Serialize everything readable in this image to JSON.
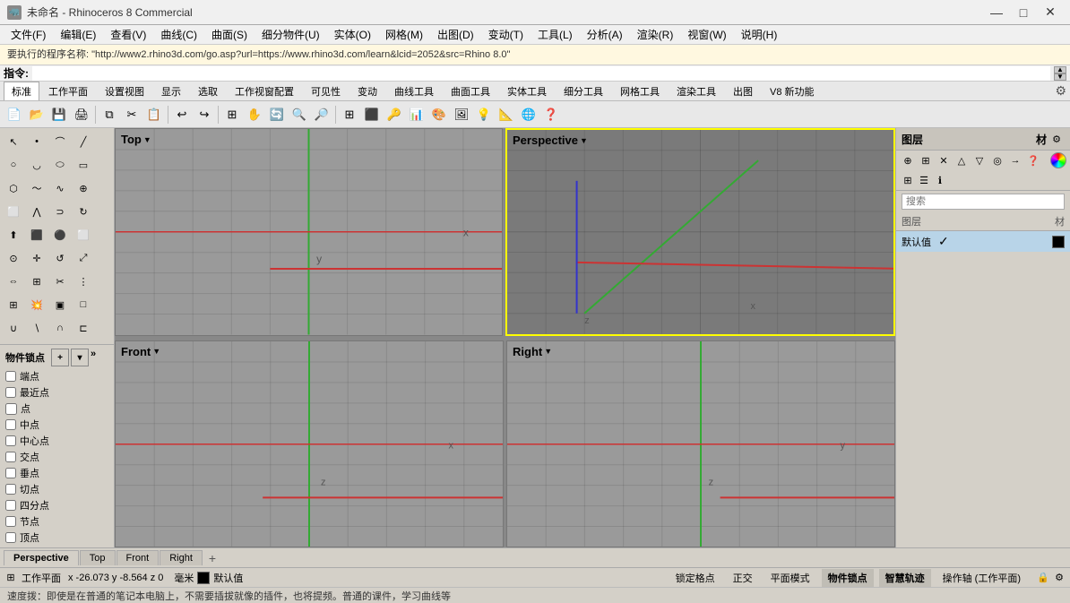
{
  "titlebar": {
    "icon": "🦏",
    "title": "未命名 - Rhinoceros 8 Commercial",
    "minimize": "—",
    "maximize": "□",
    "close": "✕"
  },
  "menubar": {
    "items": [
      {
        "label": "文件(F)"
      },
      {
        "label": "编辑(E)"
      },
      {
        "label": "查看(V)"
      },
      {
        "label": "曲线(C)"
      },
      {
        "label": "曲面(S)"
      },
      {
        "label": "细分物件(U)"
      },
      {
        "label": "实体(O)"
      },
      {
        "label": "网格(M)"
      },
      {
        "label": "出图(D)"
      },
      {
        "label": "变动(T)"
      },
      {
        "label": "工具(L)"
      },
      {
        "label": "分析(A)"
      },
      {
        "label": "渲染(R)"
      },
      {
        "label": "视窗(W)"
      },
      {
        "label": "说明(H)"
      }
    ]
  },
  "urlbar": {
    "text": "要执行的程序名称: \"http://www2.rhino3d.com/go.asp?url=https://www.rhino3d.com/learn&lcid=2052&src=Rhino 8.0\""
  },
  "commandbar": {
    "label": "指令:"
  },
  "toolbar_tabs": {
    "tabs": [
      {
        "label": "标准",
        "active": true
      },
      {
        "label": "工作平面"
      },
      {
        "label": "设置视图"
      },
      {
        "label": "显示"
      },
      {
        "label": "选取"
      },
      {
        "label": "工作视窗配置"
      },
      {
        "label": "可见性"
      },
      {
        "label": "变动"
      },
      {
        "label": "曲线工具"
      },
      {
        "label": "曲面工具"
      },
      {
        "label": "实体工具"
      },
      {
        "label": "细分工具"
      },
      {
        "label": "网格工具"
      },
      {
        "label": "渲染工具"
      },
      {
        "label": "出图"
      },
      {
        "label": "V8 新功能"
      }
    ]
  },
  "viewports": {
    "top_left": {
      "label": "Top",
      "label_arrow": "▼"
    },
    "top_right": {
      "label": "Perspective",
      "label_arrow": "▼",
      "active": true
    },
    "bottom_left": {
      "label": "Front",
      "label_arrow": "▼"
    },
    "bottom_right": {
      "label": "Right",
      "label_arrow": "▼"
    }
  },
  "right_panel": {
    "title": "图层",
    "search_placeholder": "搜索",
    "layers_header": "图层",
    "material_label": "材",
    "layers": [
      {
        "name": "默认值",
        "check": true,
        "color": "#000000",
        "selected": true
      }
    ]
  },
  "vp_tabs": {
    "tabs": [
      {
        "label": "Perspective",
        "active": true
      },
      {
        "label": "Top"
      },
      {
        "label": "Front"
      },
      {
        "label": "Right"
      }
    ],
    "add": "+"
  },
  "statusbar": {
    "workplane": "工作平面",
    "coords": "x -26.073  y -8.564  z 0",
    "unit": "毫米",
    "swatch_color": "#000000",
    "default_label": "默认值",
    "grid_lock": "锁定格点",
    "ortho": "正交",
    "plane_mode": "平面模式",
    "osnap": "物件锁点",
    "smarttrack": "智慧轨迹",
    "gumball": "操作轴 (工作平面)"
  },
  "bottombar": {
    "text": "速度拨：即使是在普通的笔记本电脑上，不需要插拔就像的插件，也将提频。普通的课件，学习曲线等"
  },
  "object_snap": {
    "title": "物件锁点",
    "items": [
      {
        "label": "端点",
        "checked": false
      },
      {
        "label": "最近点",
        "checked": false
      },
      {
        "label": "点",
        "checked": false
      },
      {
        "label": "中点",
        "checked": false
      },
      {
        "label": "中心点",
        "checked": false
      },
      {
        "label": "交点",
        "checked": false
      },
      {
        "label": "垂点",
        "checked": false
      },
      {
        "label": "切点",
        "checked": false
      },
      {
        "label": "四分点",
        "checked": false
      },
      {
        "label": "节点",
        "checked": false
      },
      {
        "label": "顶点",
        "checked": false
      }
    ]
  },
  "colors": {
    "viewport_bg": "#9a9a9a",
    "perspective_bg": "#8a8a8a",
    "grid_line": "rgba(0,0,0,0.12)",
    "axis_red": "#cc3333",
    "axis_green": "#33aa33",
    "axis_blue": "#3333cc"
  }
}
